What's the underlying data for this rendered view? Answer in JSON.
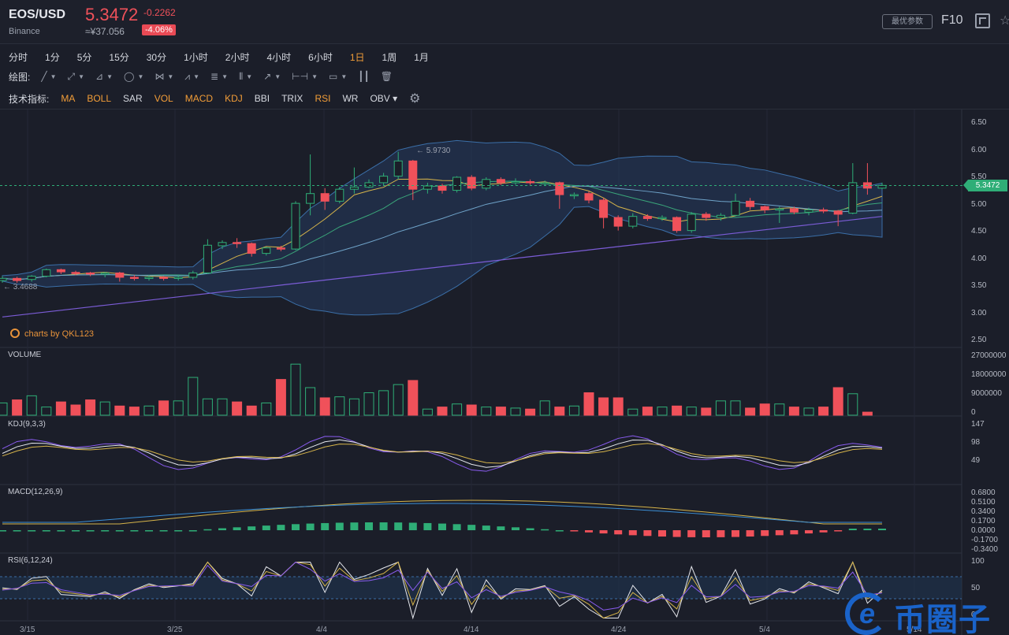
{
  "header": {
    "symbol": "EOS/USD",
    "exchange": "Binance",
    "last_price": "5.3472",
    "cny_price": "≈¥37.056",
    "change": "-0.2262",
    "change_pct": "-4.06%",
    "param_button": "最优参数",
    "f10_button": "F10",
    "expand_icon": "expand-icon",
    "star_icon": "star-icon"
  },
  "periods": {
    "items": [
      "分时",
      "1分",
      "5分",
      "15分",
      "30分",
      "1小时",
      "2小时",
      "4小时",
      "6小时",
      "1日",
      "1周",
      "1月"
    ],
    "active": "1日"
  },
  "drawing": {
    "label": "绘图:",
    "tools": [
      "line-tool-icon",
      "ray-tool-icon",
      "channel-tool-icon",
      "circle-tool-icon",
      "zigzag-tool-icon",
      "pattern-tool-icon",
      "fibonacci-tool-icon",
      "vertical-lines-icon",
      "arrow-tool-icon",
      "range-tool-icon",
      "comment-tool-icon",
      "bars-tool-icon",
      "trash-icon"
    ]
  },
  "indicators": {
    "label": "技术指标:",
    "items": [
      {
        "name": "MA",
        "active": true
      },
      {
        "name": "BOLL",
        "active": true
      },
      {
        "name": "SAR",
        "active": false
      },
      {
        "name": "VOL",
        "active": true
      },
      {
        "name": "MACD",
        "active": true
      },
      {
        "name": "KDJ",
        "active": true
      },
      {
        "name": "BBI",
        "active": false
      },
      {
        "name": "TRIX",
        "active": false
      },
      {
        "name": "RSI",
        "active": true
      },
      {
        "name": "WR",
        "active": false
      },
      {
        "name": "OBV ▾",
        "active": false
      }
    ],
    "settings_icon": "gear-icon"
  },
  "credit": "charts by QKL123",
  "current_price_tag": "5.3472",
  "high_annotation": "5.9730",
  "low_annotation": "3.4688",
  "panels": {
    "volume": "VOLUME",
    "kdj": "KDJ(9,3,3)",
    "macd": "MACD(12,26,9)",
    "rsi": "RSI(6,12,24)"
  },
  "watermark": "币圈子",
  "colors": {
    "up": "#2fae77",
    "down": "#f0515a",
    "accent": "#f29d38",
    "boll": "#3b6fa8",
    "ma_long": "#7b5cd6"
  },
  "chart_data": [
    {
      "type": "candlestick",
      "title": "EOS/USD",
      "ylim": [
        2.5,
        6.5
      ],
      "yticks": [
        "6.50",
        "6.00",
        "5.50",
        "5.00",
        "4.50",
        "4.00",
        "3.50",
        "3.00",
        "2.50"
      ],
      "xticks": [
        "3/15",
        "3/25",
        "4/4",
        "4/14",
        "4/24",
        "5/4",
        "5/14"
      ],
      "candles": [
        [
          3.6,
          3.64,
          3.56,
          3.68
        ],
        [
          3.64,
          3.6,
          3.56,
          3.67
        ],
        [
          3.62,
          3.68,
          3.58,
          3.7
        ],
        [
          3.68,
          3.8,
          3.66,
          3.82
        ],
        [
          3.8,
          3.76,
          3.72,
          3.82
        ],
        [
          3.75,
          3.74,
          3.7,
          3.78
        ],
        [
          3.74,
          3.72,
          3.68,
          3.76
        ],
        [
          3.72,
          3.74,
          3.66,
          3.76
        ],
        [
          3.74,
          3.66,
          3.58,
          3.76
        ],
        [
          3.66,
          3.64,
          3.6,
          3.7
        ],
        [
          3.64,
          3.66,
          3.6,
          3.7
        ],
        [
          3.66,
          3.64,
          3.6,
          3.68
        ],
        [
          3.64,
          3.66,
          3.6,
          3.7
        ],
        [
          3.66,
          3.74,
          3.62,
          3.78
        ],
        [
          3.74,
          4.25,
          3.72,
          4.36
        ],
        [
          4.24,
          4.3,
          4.18,
          4.34
        ],
        [
          4.3,
          4.28,
          4.2,
          4.38
        ],
        [
          4.28,
          4.1,
          4.04,
          4.3
        ],
        [
          4.1,
          4.2,
          4.06,
          4.22
        ],
        [
          4.2,
          4.18,
          4.14,
          4.24
        ],
        [
          4.18,
          5.02,
          4.16,
          5.06
        ],
        [
          5.02,
          5.2,
          4.8,
          5.92
        ],
        [
          5.2,
          5.06,
          4.9,
          5.3
        ],
        [
          5.06,
          5.28,
          5.02,
          5.32
        ],
        [
          5.28,
          5.32,
          5.2,
          5.68
        ],
        [
          5.32,
          5.4,
          5.3,
          5.46
        ],
        [
          5.4,
          5.52,
          5.34,
          5.58
        ],
        [
          5.52,
          5.8,
          5.46,
          5.97
        ],
        [
          5.8,
          5.28,
          5.08,
          5.82
        ],
        [
          5.28,
          5.34,
          5.2,
          5.4
        ],
        [
          5.34,
          5.26,
          5.2,
          5.38
        ],
        [
          5.26,
          5.5,
          5.22,
          5.52
        ],
        [
          5.5,
          5.3,
          5.26,
          5.54
        ],
        [
          5.3,
          5.46,
          5.26,
          5.5
        ],
        [
          5.46,
          5.4,
          5.36,
          5.5
        ],
        [
          5.4,
          5.42,
          5.36,
          5.48
        ],
        [
          5.42,
          5.4,
          5.36,
          5.46
        ],
        [
          5.4,
          5.4,
          5.34,
          5.44
        ],
        [
          5.4,
          5.18,
          4.92,
          5.42
        ],
        [
          5.18,
          5.18,
          5.1,
          5.22
        ],
        [
          5.2,
          5.08,
          5.02,
          5.24
        ],
        [
          5.08,
          4.76,
          4.56,
          5.12
        ],
        [
          4.76,
          4.6,
          4.52,
          4.8
        ],
        [
          4.6,
          4.78,
          4.56,
          4.84
        ],
        [
          4.78,
          4.74,
          4.7,
          4.82
        ],
        [
          4.74,
          4.76,
          4.7,
          4.8
        ],
        [
          4.76,
          4.52,
          4.48,
          4.78
        ],
        [
          4.52,
          4.82,
          4.48,
          4.86
        ],
        [
          4.82,
          4.76,
          4.7,
          4.86
        ],
        [
          4.76,
          4.8,
          4.7,
          4.84
        ],
        [
          4.8,
          5.06,
          4.78,
          5.2
        ],
        [
          5.06,
          4.96,
          4.9,
          5.12
        ],
        [
          4.96,
          4.9,
          4.84,
          4.98
        ],
        [
          4.9,
          4.92,
          4.66,
          4.96
        ],
        [
          4.92,
          4.86,
          4.82,
          4.96
        ],
        [
          4.86,
          4.9,
          4.8,
          4.94
        ],
        [
          4.9,
          4.88,
          4.84,
          4.94
        ],
        [
          4.88,
          4.82,
          4.6,
          4.9
        ],
        [
          4.84,
          5.4,
          4.82,
          5.76
        ],
        [
          5.4,
          5.3,
          5.18,
          5.76
        ],
        [
          5.3,
          5.35,
          5.28,
          5.4
        ]
      ],
      "volume_yticks": [
        "27000000",
        "18000000",
        "9000000",
        "0"
      ],
      "volume_scale_max": 27000000,
      "volume": [
        6,
        7.5,
        9.5,
        4,
        6.5,
        5,
        7.5,
        6.5,
        4.5,
        4,
        4.5,
        7,
        7,
        18.5,
        8,
        8,
        6.5,
        4.5,
        6,
        17.5,
        25,
        13.5,
        8.5,
        9,
        8,
        11,
        12,
        15,
        17,
        3,
        4,
        5.5,
        5,
        4,
        4,
        3.5,
        3,
        7,
        4,
        4.5,
        11,
        8.5,
        8.5,
        3,
        4,
        4,
        4.5,
        4,
        3.5,
        7,
        7,
        3.5,
        5.5,
        5.5,
        4,
        3.5,
        4,
        13.5,
        10.5,
        1.5
      ]
    },
    {
      "type": "line",
      "title": "KDJ(9,3,3)",
      "yticks": [
        "147",
        "98",
        "49"
      ]
    },
    {
      "type": "line",
      "title": "MACD(12,26,9)",
      "yticks": [
        "0.6800",
        "0.5100",
        "0.3400",
        "0.1700",
        "0.0000",
        "-0.1700",
        "-0.3400"
      ]
    },
    {
      "type": "line",
      "title": "RSI(6,12,24)",
      "yticks": [
        "100",
        "50",
        "0"
      ]
    }
  ]
}
